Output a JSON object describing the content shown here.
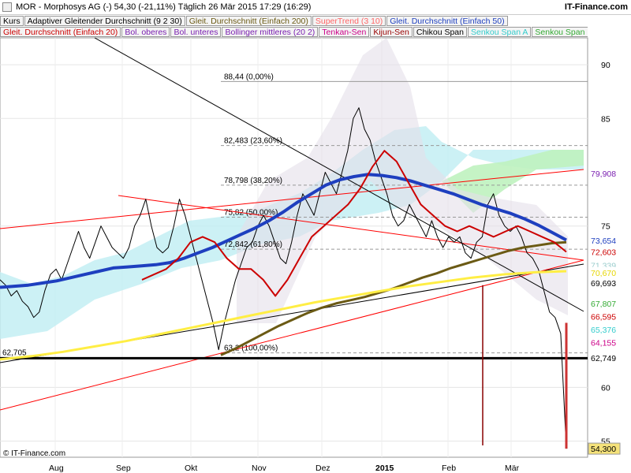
{
  "header": {
    "title": "MOR - Morphosys AG (-)    54,30 (-21,11%)    Täglich  26 Mär 2015 17:29 (16:29)",
    "site": "IT-Finance.com"
  },
  "legend": {
    "row1": [
      {
        "label": "Kurs",
        "color": "#000000"
      },
      {
        "label": "Adaptiver Gleitender Durchschnitt (9 2 30)",
        "color": "#000000"
      },
      {
        "label": "Gleit. Durchschnitt (Einfach 200)",
        "color": "#6b5a14"
      },
      {
        "label": "SuperTrend (3 10)",
        "color": "#ff6666"
      },
      {
        "label": "Gleit. Durchschnitt (Einfach 50)",
        "color": "#1e3fbf"
      }
    ],
    "row2": [
      {
        "label": "Gleit. Durchschnitt (Einfach 20)",
        "color": "#cc0000"
      },
      {
        "label": "Bol. oberes",
        "color": "#7a1fb0"
      },
      {
        "label": "Bol. unteres",
        "color": "#7a1fb0"
      },
      {
        "label": "Bollinger mittleres (20 2)",
        "color": "#7a1fb0"
      },
      {
        "label": "Tenkan-Sen",
        "color": "#cc0088"
      },
      {
        "label": "Kijun-Sen",
        "color": "#990000"
      },
      {
        "label": "Chikou Span",
        "color": "#000000"
      },
      {
        "label": "Senkou Span A",
        "color": "#33cccc"
      },
      {
        "label": "Senkou Span B",
        "color": "#33aa33"
      }
    ]
  },
  "copyright": "© IT-Finance.com",
  "chart_data": {
    "type": "line",
    "instrument": "MOR - Morphosys AG",
    "last_price": "54,30",
    "change": "-21,11%",
    "ylim": [
      53.5,
      92.5
    ],
    "yticks": [
      "90",
      "85",
      "75",
      "60",
      "55"
    ],
    "xticks": [
      "Aug",
      "Sep",
      "Okt",
      "Nov",
      "Dez",
      "2015",
      "Feb",
      "Mär"
    ],
    "fib_levels": [
      {
        "label": "88,44 (0,00%)",
        "value": 88.44
      },
      {
        "label": "82,483 (23,60%)",
        "value": 82.483
      },
      {
        "label": "78,798 (38,20%)",
        "value": 78.798
      },
      {
        "label": "75,82 (50,00%)",
        "value": 75.82
      },
      {
        "label": "72,842 (61,80%)",
        "value": 72.842
      },
      {
        "label": "63,2 (100,00%)",
        "value": 63.2
      }
    ],
    "support_label": "62,705",
    "right_labels": [
      {
        "text": "79,908",
        "value": 79.908,
        "bg": "#ffffff",
        "fg": "#7a1fb0"
      },
      {
        "text": "73,654",
        "value": 73.654,
        "bg": "#ffffff",
        "fg": "#1e3fbf"
      },
      {
        "text": "72,603",
        "value": 72.603,
        "bg": "#ffffff",
        "fg": "#cc0000"
      },
      {
        "text": "71,339",
        "value": 71.339,
        "bg": "#ffffff",
        "fg": "#99cccc"
      },
      {
        "text": "70,670",
        "value": 70.67,
        "bg": "#ffffff",
        "fg": "#e6d600"
      },
      {
        "text": "69,693",
        "value": 69.693,
        "bg": "#ffffff",
        "fg": "#000000"
      },
      {
        "text": "67,807",
        "value": 67.807,
        "bg": "#ffffff",
        "fg": "#33aa33"
      },
      {
        "text": "66,595",
        "value": 66.595,
        "bg": "#ffffff",
        "fg": "#cc0000"
      },
      {
        "text": "65,376",
        "value": 65.376,
        "bg": "#ffffff",
        "fg": "#33cccc"
      },
      {
        "text": "64,155",
        "value": 64.155,
        "bg": "#ffffff",
        "fg": "#cc0088"
      },
      {
        "text": "62,749",
        "value": 62.749,
        "bg": "#ffffff",
        "fg": "#000000"
      },
      {
        "text": "54,300",
        "value": 54.3,
        "bg": "#f5e27a",
        "fg": "#000000"
      }
    ],
    "series": [
      {
        "name": "Kurs",
        "color": "#000000",
        "values": [
          70,
          69.5,
          68.5,
          69,
          68,
          67.5,
          66.5,
          67,
          69,
          70.5,
          71,
          70,
          71.5,
          73,
          74.5,
          73,
          72,
          73.5,
          75,
          74,
          73,
          72.5,
          72,
          73,
          75,
          76,
          77.5,
          75,
          73,
          72.5,
          73,
          75,
          77.5,
          76,
          74,
          72,
          70,
          68,
          66,
          63.5,
          66,
          68,
          70,
          71.5,
          73,
          73.5,
          75,
          76,
          75,
          73.5,
          72,
          71.5,
          73.5,
          76,
          78,
          77,
          76,
          78,
          80,
          79,
          78,
          80,
          82,
          85,
          86,
          84,
          83,
          81,
          79.5,
          78,
          76,
          75,
          75.5,
          77,
          76,
          75,
          74,
          75.5,
          74,
          73,
          74,
          73.5,
          74,
          72.5,
          72,
          73.5,
          74,
          77,
          78,
          76,
          75,
          74.5,
          75,
          74,
          72.5,
          72,
          71,
          69,
          67,
          66.5,
          65,
          54.3
        ]
      },
      {
        "name": "Gleit. Durchschnitt (Einfach 50)",
        "color": "#1e3fbf",
        "values": [
          69.3,
          69.4,
          69.5,
          69.7,
          69.9,
          70.2,
          70.5,
          70.8,
          71.1,
          71.2,
          71.3,
          71.4,
          71.6,
          72,
          72.5,
          73,
          73.6,
          74.2,
          74.8,
          75.5,
          76.3,
          77.2,
          78,
          78.8,
          79.3,
          79.6,
          79.8,
          79.7,
          79.5,
          79.2,
          78.8,
          78.4,
          78,
          77.5,
          77,
          76.6,
          76.2,
          75.7,
          75.1,
          74.4,
          73.7
        ]
      },
      {
        "name": "Gleit. Durchschnitt (Einfach 200)",
        "color": "#6b5a14",
        "values": [
          63,
          63.6,
          64.3,
          65,
          65.7,
          66.3,
          66.9,
          67.4,
          67.8,
          68.1,
          68.4,
          68.8,
          69.2,
          69.7,
          70.2,
          70.6,
          71.1,
          71.5,
          71.9,
          72.3,
          72.7,
          73,
          73.2,
          73.4,
          73.5
        ]
      },
      {
        "name": "Gleit. Durchschnitt (Einfach 20)",
        "color": "#cc0000",
        "values": [
          70,
          70.5,
          71,
          72,
          73.5,
          74,
          73.5,
          72,
          71,
          71,
          70,
          68.5,
          70,
          72,
          74,
          75,
          76,
          77,
          78.5,
          80.5,
          82,
          81,
          79,
          77,
          76,
          75,
          74.5,
          75,
          74.5,
          74,
          74.5,
          75,
          74.5,
          74,
          73.5,
          72.6
        ]
      },
      {
        "name": "Yellow",
        "color": "#ffee44",
        "values": [
          62.6,
          62.9,
          63.3,
          63.8,
          64.3,
          64.9,
          65.5,
          66.1,
          66.7,
          67.3,
          67.9,
          68.4,
          68.9,
          69.4,
          69.8,
          70.2,
          70.5,
          70.7,
          70.8
        ]
      }
    ]
  }
}
